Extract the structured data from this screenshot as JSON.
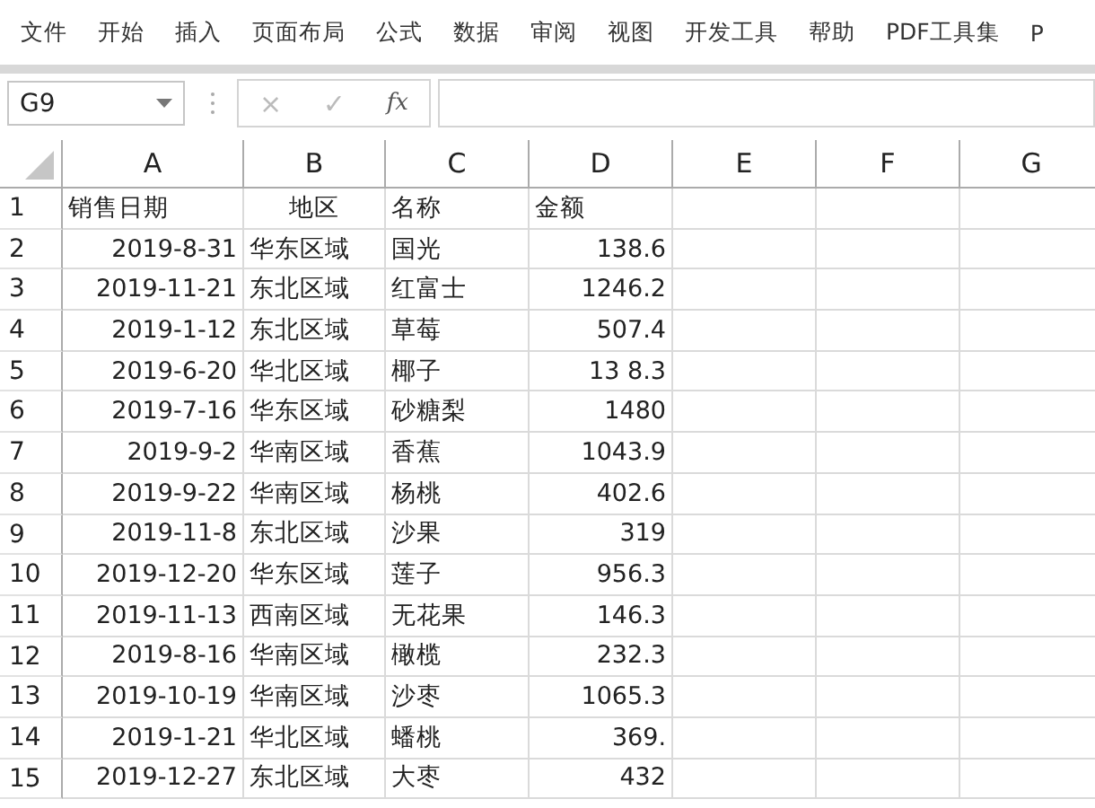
{
  "menu": [
    "文件",
    "开始",
    "插入",
    "页面布局",
    "公式",
    "数据",
    "审阅",
    "视图",
    "开发工具",
    "帮助",
    "PDF工具集",
    "P"
  ],
  "name_box": "G9",
  "formula_buttons": [
    "×",
    "✓",
    "fx"
  ],
  "columns": [
    "A",
    "B",
    "C",
    "D",
    "E",
    "F",
    "G"
  ],
  "rows": [
    {
      "num": "1",
      "cells": [
        "销售日期",
        "地区",
        "名称",
        "金额"
      ],
      "kind": "header"
    },
    {
      "num": "2",
      "cells": [
        "2019-8-31",
        "华东区域",
        "国光",
        "138.6"
      ],
      "kind": "data"
    },
    {
      "num": "3",
      "cells": [
        "2019-11-21",
        "东北区域",
        "红富士",
        "1246.2"
      ],
      "kind": "data"
    },
    {
      "num": "4",
      "cells": [
        "2019-1-12",
        "东北区域",
        "草莓",
        "507.4"
      ],
      "kind": "data"
    },
    {
      "num": "5",
      "cells": [
        "2019-6-20",
        "华北区域",
        "椰子",
        "13 8.3"
      ],
      "kind": "data"
    },
    {
      "num": "6",
      "cells": [
        "2019-7-16",
        "华东区域",
        "砂糖梨",
        "1480"
      ],
      "kind": "data"
    },
    {
      "num": "7",
      "cells": [
        "2019-9-2",
        "华南区域",
        "香蕉",
        "1043.9"
      ],
      "kind": "data"
    },
    {
      "num": "8",
      "cells": [
        "2019-9-22",
        "华南区域",
        "杨桃",
        "402.6"
      ],
      "kind": "data"
    },
    {
      "num": "9",
      "cells": [
        "2019-11-8",
        "东北区域",
        "沙果",
        "319"
      ],
      "kind": "data"
    },
    {
      "num": "10",
      "cells": [
        "2019-12-20",
        "华东区域",
        "莲子",
        "956.3"
      ],
      "kind": "data"
    },
    {
      "num": "11",
      "cells": [
        "2019-11-13",
        "西南区域",
        "无花果",
        "146.3"
      ],
      "kind": "data"
    },
    {
      "num": "12",
      "cells": [
        "2019-8-16",
        "华南区域",
        "橄榄",
        "232.3"
      ],
      "kind": "data"
    },
    {
      "num": "13",
      "cells": [
        "2019-10-19",
        "华南区域",
        "沙枣",
        "1065.3"
      ],
      "kind": "data"
    },
    {
      "num": "14",
      "cells": [
        "2019-1-21",
        "华北区域",
        "蟠桃",
        "369."
      ],
      "kind": "data"
    },
    {
      "num": "15",
      "cells": [
        "2019-12-27",
        "东北区域",
        "大枣",
        "432"
      ],
      "kind": "data"
    }
  ]
}
